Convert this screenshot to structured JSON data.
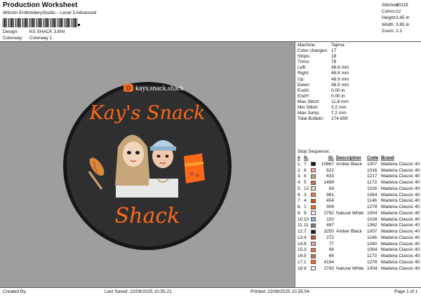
{
  "header": {
    "title": "Production Worksheet",
    "subtitle": "Wilcom EmbroideryStudio – Level 3 Advanced",
    "design_label": "Design:",
    "design_value": "KS SHACK 3.8IN",
    "colorway_label": "Colorway:",
    "colorway_value": "Colorway 1"
  },
  "stats": [
    {
      "k": "Stitches:",
      "v": "30119"
    },
    {
      "k": "Colors:",
      "v": "12"
    },
    {
      "k": "Height:",
      "v": "3.85 in"
    },
    {
      "k": "Width:",
      "v": "3.85 in"
    },
    {
      "k": "Zoom:",
      "v": "1:1"
    }
  ],
  "machine_info": [
    {
      "k": "Machine:",
      "v": "Tajima"
    },
    {
      "k": "Color changes:",
      "v": "17"
    },
    {
      "k": "Stops:",
      "v": "18"
    },
    {
      "k": "Trims:",
      "v": "78"
    },
    {
      "k": "Left:",
      "v": "48.8 mm"
    },
    {
      "k": "Right:",
      "v": "48.8 mm"
    },
    {
      "k": "Up:",
      "v": "48.9 mm"
    },
    {
      "k": "Down:",
      "v": "48.9 mm"
    },
    {
      "k": "EndX:",
      "v": "0.00 in"
    },
    {
      "k": "EndY:",
      "v": "0.00 in"
    },
    {
      "k": "Max Stitch:",
      "v": "11.8 mm"
    },
    {
      "k": "Min Stitch:",
      "v": "0.2 mm"
    },
    {
      "k": "Max Jump:",
      "v": "7.2 mm"
    },
    {
      "k": "Total Bobbin:",
      "v": "174.65ft"
    }
  ],
  "stop_sequence": {
    "title": "Stop Sequence:",
    "headers": {
      "num": "#",
      "n": "N.",
      "st": "St.",
      "desc": "Description",
      "code": "Code",
      "brand": "Brand"
    },
    "rows": [
      {
        "num": "1.",
        "n": "7",
        "color": "#1a1a1a",
        "st": "10667",
        "desc": "Amber Black",
        "code": "1007",
        "brand": "Madeira Classic 40"
      },
      {
        "num": "2.",
        "n": "8",
        "color": "#f0a7a0",
        "st": "822",
        "desc": "",
        "code": "1016",
        "brand": "Madeira Classic 40"
      },
      {
        "num": "3.",
        "n": "6",
        "color": "#c7a77a",
        "st": "633",
        "desc": "",
        "code": "1217",
        "brand": "Madeira Classic 40"
      },
      {
        "num": "4.",
        "n": "5",
        "color": "#b9774a",
        "st": "1489",
        "desc": "",
        "code": "1173",
        "brand": "Madeira Classic 40"
      },
      {
        "num": "5.",
        "n": "12",
        "color": "#f3d7bd",
        "st": "69",
        "desc": "",
        "code": "1026",
        "brand": "Madeira Classic 40"
      },
      {
        "num": "6.",
        "n": "3",
        "color": "#e27b4d",
        "st": "981",
        "desc": "",
        "code": "1064",
        "brand": "Madeira Classic 40"
      },
      {
        "num": "7.",
        "n": "4",
        "color": "#c8562c",
        "st": "454",
        "desc": "",
        "code": "1146",
        "brand": "Madeira Classic 40"
      },
      {
        "num": "8.",
        "n": "1",
        "color": "#ff6a1a",
        "st": "906",
        "desc": "",
        "code": "1278",
        "brand": "Madeira Classic 40"
      },
      {
        "num": "9.",
        "n": "9",
        "color": "#f4f4f4",
        "st": "2792",
        "desc": "Natural White",
        "code": "1004",
        "brand": "Madeira Classic 40"
      },
      {
        "num": "10.",
        "n": "10",
        "color": "#8fb3cf",
        "st": "150",
        "desc": "",
        "code": "1028",
        "brand": "Madeira Classic 40"
      },
      {
        "num": "11.",
        "n": "11",
        "color": "#7a7a7a",
        "st": "487",
        "desc": "",
        "code": "1362",
        "brand": "Madeira Classic 40"
      },
      {
        "num": "12.",
        "n": "7",
        "color": "#1a1a1a",
        "st": "3250",
        "desc": "Amber Black",
        "code": "1007",
        "brand": "Madeira Classic 40"
      },
      {
        "num": "13.",
        "n": "4",
        "color": "#c8562c",
        "st": "272",
        "desc": "",
        "code": "1146",
        "brand": "Madeira Classic 40"
      },
      {
        "num": "14.",
        "n": "8",
        "color": "#f0a7a0",
        "st": "77",
        "desc": "",
        "code": "1040",
        "brand": "Madeira Classic 40"
      },
      {
        "num": "15.",
        "n": "3",
        "color": "#e27b4d",
        "st": "66",
        "desc": "",
        "code": "1064",
        "brand": "Madeira Classic 40"
      },
      {
        "num": "16.",
        "n": "5",
        "color": "#b9774a",
        "st": "66",
        "desc": "",
        "code": "1173",
        "brand": "Madeira Classic 40"
      },
      {
        "num": "17.",
        "n": "1",
        "color": "#ff6a1a",
        "st": "4194",
        "desc": "",
        "code": "1278",
        "brand": "Madeira Classic 40"
      },
      {
        "num": "18.",
        "n": "9",
        "color": "#f4f4f4",
        "st": "2742",
        "desc": "Natural White",
        "code": "1004",
        "brand": "Madeira Classic 40"
      }
    ]
  },
  "artwork": {
    "handle": "kays.snack.shack",
    "line1": "Kay's Snack",
    "line2": "Shack",
    "bag_label": "Cheetos",
    "colors": {
      "patch": "#2f2f2f",
      "border": "#161616",
      "accent": "#ff6a1a",
      "background": "#9e9e9e"
    }
  },
  "footer": {
    "created": "Created By:",
    "saved": "Last Saved: 22/08/2025 10.55.21",
    "printed": "Printed: 22/08/2025 10.55.54",
    "page": "Page 1 of 1"
  }
}
